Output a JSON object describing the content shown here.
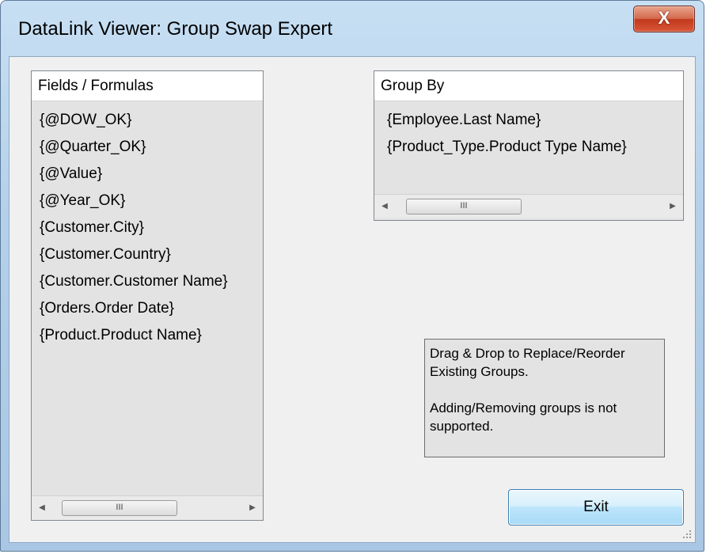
{
  "window": {
    "title": "DataLink Viewer: Group Swap Expert",
    "close_label": "X"
  },
  "fields_panel": {
    "header": "Fields / Formulas",
    "items": [
      "{@DOW_OK}",
      "{@Quarter_OK}",
      "{@Value}",
      "{@Year_OK}",
      "{Customer.City}",
      "{Customer.Country}",
      "{Customer.Customer Name}",
      "{Orders.Order Date}",
      "{Product.Product Name}"
    ],
    "scroll_thumb": "III"
  },
  "group_panel": {
    "header": "Group By",
    "items": [
      "{Employee.Last Name}",
      "{Product_Type.Product Type Name}"
    ],
    "scroll_thumb": "III"
  },
  "info": {
    "line1": "Drag & Drop to Replace/Reorder Existing Groups.",
    "line2": "Adding/Removing groups is not supported."
  },
  "buttons": {
    "exit": "Exit"
  },
  "icons": {
    "close": "close-icon",
    "scroll_left": "arrow-left-icon",
    "scroll_right": "arrow-right-icon",
    "resize": "resize-grip-icon"
  }
}
